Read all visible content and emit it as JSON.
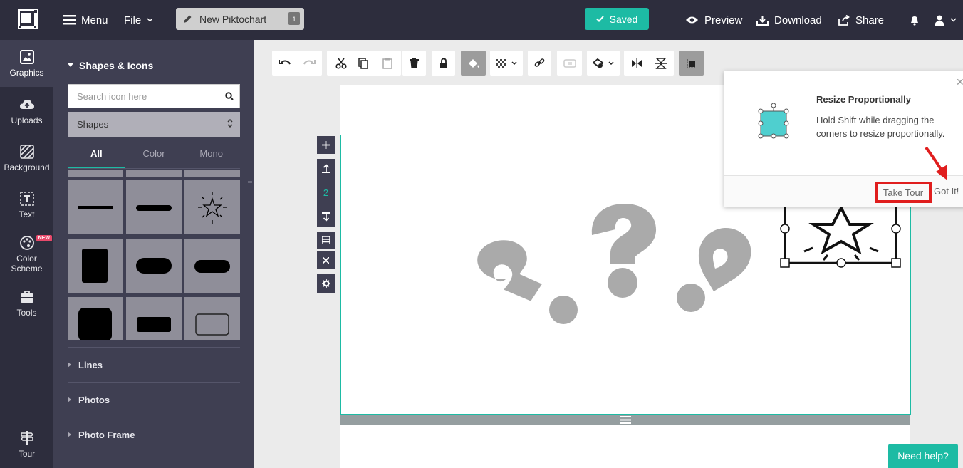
{
  "topbar": {
    "menu_label": "Menu",
    "file_label": "File",
    "doc_title": "New Piktochart",
    "page_count": "1",
    "saved_label": "Saved",
    "preview_label": "Preview",
    "download_label": "Download",
    "share_label": "Share"
  },
  "rail": {
    "items": [
      {
        "label": "Graphics",
        "icon": "image-icon"
      },
      {
        "label": "Uploads",
        "icon": "cloud-upload-icon"
      },
      {
        "label": "Background",
        "icon": "hatch-icon"
      },
      {
        "label": "Text",
        "icon": "text-icon"
      },
      {
        "label": "Color Scheme",
        "icon": "palette-icon",
        "badge": "NEW"
      },
      {
        "label": "Tools",
        "icon": "toolbox-icon"
      },
      {
        "label": "Tour",
        "icon": "signpost-icon"
      }
    ]
  },
  "panel": {
    "heading": "Shapes & Icons",
    "search_placeholder": "Search icon here",
    "category": "Shapes",
    "tabs": [
      "All",
      "Color",
      "Mono"
    ],
    "sections": [
      "Lines",
      "Photos",
      "Photo Frame"
    ]
  },
  "canvas": {
    "block_number": "2"
  },
  "tooltip": {
    "title": "Resize Proportionally",
    "text": "Hold Shift while dragging the corners to resize proportionally.",
    "take_tour": "Take Tour",
    "got_it": "Got It!"
  },
  "help_label": "Need help?",
  "colors": {
    "accent": "#1dbba4",
    "topbar": "#2d2d3d",
    "panel": "#3f3f52",
    "highlight": "#e01e1e"
  }
}
